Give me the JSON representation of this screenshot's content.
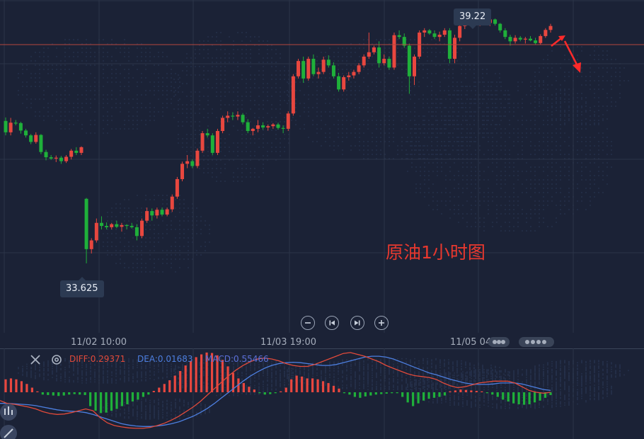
{
  "title": "原油1小时图",
  "price_high_label": "39.22",
  "price_low_label": "33.625",
  "time_labels": [
    "11/02 10:00",
    "11/03 19:00",
    "11/05 04:00"
  ],
  "macd_legend": {
    "diff": "DIFF:0.29371",
    "dea": "DEA:0.01683",
    "macd": "MACD:0.55466"
  },
  "colors": {
    "up": "#e8473f",
    "down": "#1fb03a",
    "diff": "#e24a3a",
    "dea": "#4d7fe0",
    "arrow": "#ff2a2a",
    "background": "#1b2236"
  },
  "icons": [
    "zoom-out-icon",
    "skip-back-icon",
    "skip-forward-icon",
    "zoom-in-icon",
    "close-icon",
    "settings-icon"
  ],
  "chart_data": [
    {
      "type": "candlestick",
      "description": "price candles (approximate)",
      "ylim": [
        33.3,
        39.45
      ],
      "reference_line": 39.22,
      "candles": [
        [
          36.88,
          36.96,
          36.55,
          36.62
        ],
        [
          36.62,
          36.95,
          36.55,
          36.84
        ],
        [
          36.84,
          36.9,
          36.78,
          36.83
        ],
        [
          36.83,
          36.86,
          36.59,
          36.66
        ],
        [
          36.66,
          36.7,
          36.5,
          36.55
        ],
        [
          36.55,
          36.58,
          36.35,
          36.4
        ],
        [
          36.4,
          36.62,
          36.36,
          36.56
        ],
        [
          36.56,
          36.58,
          36.12,
          36.17
        ],
        [
          36.17,
          36.22,
          35.98,
          36.05
        ],
        [
          36.05,
          36.1,
          35.99,
          36.02
        ],
        [
          36.02,
          36.09,
          35.94,
          36.04
        ],
        [
          36.04,
          36.08,
          35.9,
          35.96
        ],
        [
          35.96,
          36.1,
          35.92,
          36.06
        ],
        [
          36.06,
          36.24,
          36.0,
          36.2
        ],
        [
          36.2,
          36.28,
          36.1,
          36.15
        ],
        [
          36.15,
          36.3,
          36.1,
          36.28
        ],
        [
          35.1,
          35.12,
          33.625,
          33.95
        ],
        [
          33.95,
          34.2,
          33.85,
          34.15
        ],
        [
          34.15,
          34.65,
          34.1,
          34.55
        ],
        [
          34.55,
          34.7,
          34.4,
          34.48
        ],
        [
          34.48,
          34.56,
          34.4,
          34.45
        ],
        [
          34.45,
          34.55,
          34.4,
          34.52
        ],
        [
          34.52,
          34.6,
          34.43,
          34.46
        ],
        [
          34.46,
          34.55,
          34.35,
          34.5
        ],
        [
          34.5,
          34.52,
          34.4,
          34.48
        ],
        [
          34.48,
          34.55,
          34.42,
          34.45
        ],
        [
          34.45,
          34.52,
          34.15,
          34.25
        ],
        [
          34.25,
          34.65,
          34.2,
          34.6
        ],
        [
          34.6,
          34.9,
          34.55,
          34.82
        ],
        [
          34.82,
          34.88,
          34.6,
          34.72
        ],
        [
          34.72,
          34.9,
          34.65,
          34.85
        ],
        [
          34.85,
          34.9,
          34.7,
          34.74
        ],
        [
          34.74,
          34.9,
          34.7,
          34.86
        ],
        [
          34.86,
          35.2,
          34.8,
          35.15
        ],
        [
          35.15,
          35.6,
          35.1,
          35.55
        ],
        [
          35.55,
          35.95,
          35.5,
          35.9
        ],
        [
          35.9,
          36.1,
          35.8,
          35.96
        ],
        [
          35.96,
          36.0,
          35.8,
          35.85
        ],
        [
          35.85,
          36.25,
          35.8,
          36.2
        ],
        [
          36.2,
          36.65,
          36.15,
          36.6
        ],
        [
          36.6,
          36.7,
          36.5,
          36.55
        ],
        [
          36.55,
          36.6,
          36.1,
          36.15
        ],
        [
          36.15,
          36.7,
          36.1,
          36.65
        ],
        [
          36.65,
          37.0,
          36.6,
          36.95
        ],
        [
          36.95,
          37.1,
          36.85,
          37.0
        ],
        [
          37.0,
          37.08,
          36.9,
          36.98
        ],
        [
          36.98,
          37.1,
          36.9,
          37.02
        ],
        [
          37.02,
          37.06,
          36.8,
          36.85
        ],
        [
          36.85,
          36.92,
          36.6,
          36.65
        ],
        [
          36.65,
          36.72,
          36.55,
          36.7
        ],
        [
          36.7,
          36.9,
          36.62,
          36.78
        ],
        [
          36.78,
          36.85,
          36.68,
          36.73
        ],
        [
          36.73,
          36.8,
          36.66,
          36.76
        ],
        [
          36.76,
          36.83,
          36.7,
          36.8
        ],
        [
          36.8,
          36.84,
          36.68,
          36.72
        ],
        [
          36.72,
          36.78,
          36.6,
          36.7
        ],
        [
          36.7,
          37.1,
          36.65,
          37.05
        ],
        [
          37.05,
          37.95,
          37.0,
          37.9
        ],
        [
          37.9,
          38.3,
          37.85,
          38.25
        ],
        [
          38.25,
          38.35,
          37.75,
          37.85
        ],
        [
          37.85,
          38.35,
          37.8,
          38.3
        ],
        [
          38.3,
          38.4,
          37.9,
          37.95
        ],
        [
          37.95,
          38.1,
          37.85,
          38.0
        ],
        [
          38.0,
          38.35,
          37.95,
          38.28
        ],
        [
          38.28,
          38.38,
          38.1,
          38.15
        ],
        [
          38.15,
          38.22,
          37.85,
          37.9
        ],
        [
          37.9,
          37.98,
          37.55,
          37.6
        ],
        [
          37.6,
          37.92,
          37.55,
          37.88
        ],
        [
          37.88,
          38.0,
          37.8,
          37.92
        ],
        [
          37.92,
          38.05,
          37.85,
          38.0
        ],
        [
          38.0,
          38.2,
          37.95,
          38.15
        ],
        [
          38.15,
          38.4,
          38.1,
          38.35
        ],
        [
          38.35,
          38.9,
          38.3,
          38.45
        ],
        [
          38.45,
          38.6,
          38.4,
          38.56
        ],
        [
          38.56,
          38.7,
          38.1,
          38.2
        ],
        [
          38.2,
          38.4,
          38.15,
          38.3
        ],
        [
          38.3,
          38.35,
          38.05,
          38.1
        ],
        [
          38.1,
          38.9,
          38.05,
          38.84
        ],
        [
          38.84,
          38.95,
          38.75,
          38.8
        ],
        [
          38.8,
          38.88,
          38.55,
          38.6
        ],
        [
          38.6,
          38.65,
          37.5,
          37.9
        ],
        [
          37.9,
          38.4,
          37.7,
          38.35
        ],
        [
          38.35,
          38.95,
          38.3,
          38.9
        ],
        [
          38.9,
          39.0,
          38.8,
          38.95
        ],
        [
          38.95,
          38.98,
          38.85,
          38.88
        ],
        [
          38.88,
          38.95,
          38.75,
          38.8
        ],
        [
          38.8,
          38.92,
          38.7,
          38.85
        ],
        [
          38.85,
          39.0,
          38.8,
          38.95
        ],
        [
          38.95,
          39.0,
          38.2,
          38.3
        ],
        [
          38.3,
          38.85,
          38.2,
          38.78
        ],
        [
          38.78,
          39.1,
          38.7,
          39.05
        ],
        [
          39.05,
          39.15,
          38.98,
          39.1
        ],
        [
          39.1,
          39.22,
          39.05,
          39.18
        ],
        [
          39.18,
          39.2,
          39.08,
          39.12
        ],
        [
          39.12,
          39.18,
          39.05,
          39.15
        ],
        [
          39.15,
          39.2,
          39.08,
          39.12
        ],
        [
          39.12,
          39.22,
          39.05,
          39.2
        ],
        [
          39.2,
          39.22,
          39.06,
          39.1
        ],
        [
          39.1,
          39.12,
          38.9,
          38.95
        ],
        [
          38.95,
          39.0,
          38.75,
          38.8
        ],
        [
          38.8,
          38.85,
          38.6,
          38.7
        ],
        [
          38.7,
          38.84,
          38.65,
          38.78
        ],
        [
          38.78,
          38.82,
          38.7,
          38.74
        ],
        [
          38.74,
          38.8,
          38.65,
          38.76
        ],
        [
          38.76,
          38.82,
          38.7,
          38.72
        ],
        [
          38.72,
          38.78,
          38.62,
          38.66
        ],
        [
          38.66,
          38.86,
          38.62,
          38.82
        ],
        [
          38.82,
          39.0,
          38.78,
          38.96
        ],
        [
          38.96,
          39.1,
          38.9,
          39.05
        ]
      ]
    },
    {
      "type": "macd",
      "description": "MACD histogram with DIFF and DEA lines (approximate)",
      "ylim": [
        -0.95,
        0.95
      ],
      "histogram": [
        0.28,
        0.3,
        0.28,
        0.24,
        0.18,
        0.1,
        0.02,
        -0.05,
        -0.06,
        -0.07,
        -0.08,
        -0.07,
        -0.05,
        -0.04,
        -0.05,
        -0.06,
        -0.3,
        -0.4,
        -0.45,
        -0.44,
        -0.4,
        -0.36,
        -0.3,
        -0.26,
        -0.2,
        -0.16,
        -0.1,
        -0.05,
        0.03,
        0.1,
        0.18,
        0.26,
        0.36,
        0.46,
        0.58,
        0.68,
        0.76,
        0.82,
        0.86,
        0.85,
        0.8,
        0.7,
        0.56,
        0.42,
        0.3,
        0.2,
        0.12,
        0.06,
        -0.02,
        -0.05,
        -0.04,
        -0.02,
        0.02,
        0.1,
        0.28,
        0.36,
        0.34,
        0.3,
        0.3,
        0.28,
        0.24,
        0.2,
        0.14,
        0.08,
        -0.02,
        -0.05,
        -0.1,
        -0.12,
        -0.09,
        -0.07,
        -0.05,
        -0.04,
        -0.03,
        -0.02,
        -0.02,
        -0.1,
        -0.22,
        -0.3,
        -0.24,
        -0.18,
        -0.14,
        -0.12,
        -0.1,
        -0.07,
        0.02,
        0.04,
        0.06,
        0.05,
        0.04,
        0.03,
        0.02,
        -0.02,
        -0.05,
        -0.1,
        -0.16,
        -0.2,
        -0.24,
        -0.26,
        -0.27,
        -0.26,
        -0.22,
        -0.18,
        -0.12,
        -0.06
      ],
      "diff": [
        -0.18,
        -0.24,
        -0.26,
        -0.29,
        -0.32,
        -0.36,
        -0.42,
        -0.46,
        -0.48,
        -0.47,
        -0.44,
        -0.4,
        -0.36,
        -0.4,
        -0.55,
        -0.66,
        -0.72,
        -0.75,
        -0.77,
        -0.78,
        -0.78,
        -0.76,
        -0.72,
        -0.67,
        -0.6,
        -0.52,
        -0.42,
        -0.32,
        -0.2,
        -0.06,
        0.08,
        0.22,
        0.36,
        0.48,
        0.58,
        0.66,
        0.72,
        0.74,
        0.72,
        0.68,
        0.62,
        0.58,
        0.56,
        0.56,
        0.6,
        0.66,
        0.72,
        0.78,
        0.84,
        0.86,
        0.82,
        0.78,
        0.72,
        0.66,
        0.58,
        0.52,
        0.46,
        0.4,
        0.36,
        0.34,
        0.32,
        0.28,
        0.2,
        0.14,
        0.1,
        0.12,
        0.16,
        0.2,
        0.22,
        0.24,
        0.24,
        0.24,
        0.2,
        0.12,
        0.04,
        0.0,
        -0.02,
        0.0
      ],
      "dea": [
        -0.24,
        -0.24,
        -0.25,
        -0.26,
        -0.27,
        -0.29,
        -0.32,
        -0.35,
        -0.38,
        -0.4,
        -0.41,
        -0.42,
        -0.44,
        -0.48,
        -0.53,
        -0.58,
        -0.63,
        -0.68,
        -0.71,
        -0.73,
        -0.74,
        -0.74,
        -0.73,
        -0.71,
        -0.68,
        -0.64,
        -0.58,
        -0.52,
        -0.44,
        -0.35,
        -0.24,
        -0.12,
        0.0,
        0.12,
        0.24,
        0.35,
        0.44,
        0.52,
        0.58,
        0.62,
        0.64,
        0.65,
        0.64,
        0.62,
        0.6,
        0.58,
        0.58,
        0.6,
        0.64,
        0.68,
        0.72,
        0.76,
        0.78,
        0.78,
        0.76,
        0.72,
        0.66,
        0.6,
        0.54,
        0.48,
        0.42,
        0.38,
        0.33,
        0.28,
        0.24,
        0.2,
        0.18,
        0.17,
        0.17,
        0.18,
        0.2,
        0.2,
        0.2,
        0.18,
        0.14,
        0.1,
        0.06,
        0.04
      ]
    }
  ]
}
